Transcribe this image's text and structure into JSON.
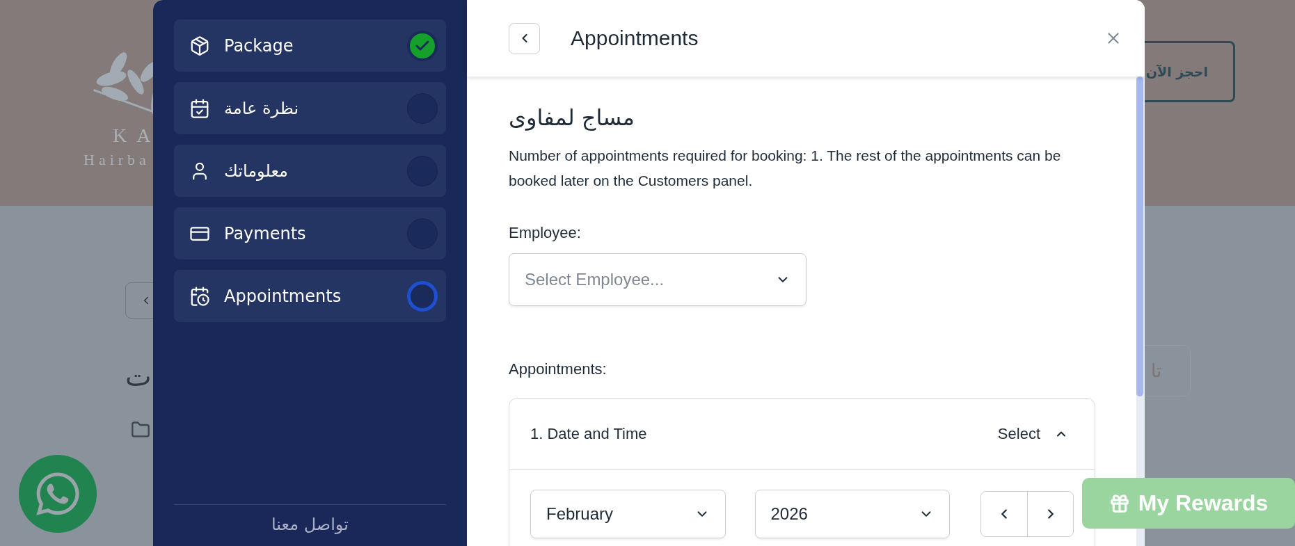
{
  "background": {
    "logo": {
      "letters": "KA",
      "subtitle": "Hairba"
    },
    "book_button": "احجز الآن",
    "heading_fragment": "ت",
    "tab_fragment": "تا"
  },
  "sidebar": {
    "steps": [
      {
        "label": "Package",
        "kind": "package",
        "completed": true,
        "selected": false
      },
      {
        "label": "نظرة عامة",
        "kind": "overview",
        "completed": false,
        "selected": false
      },
      {
        "label": "معلوماتك",
        "kind": "info",
        "completed": false,
        "selected": false
      },
      {
        "label": "Payments",
        "kind": "payments",
        "completed": false,
        "selected": false
      },
      {
        "label": "Appointments",
        "kind": "appointments",
        "completed": false,
        "selected": true
      }
    ],
    "footer_link": "تواصل معنا"
  },
  "panel": {
    "title": "Appointments",
    "service_name": "مساج لمفاوى",
    "note": "Number of appointments required for booking: 1. The rest of the appointments can be booked later on the Customers panel.",
    "employee": {
      "label": "Employee:",
      "placeholder": "Select Employee..."
    },
    "appointments_label": "Appointments:",
    "appointments": [
      {
        "title": "1. Date and Time",
        "action": "Select",
        "expanded": true,
        "month": "February",
        "year": "2026"
      }
    ]
  },
  "rewards_button": "My Rewards"
}
